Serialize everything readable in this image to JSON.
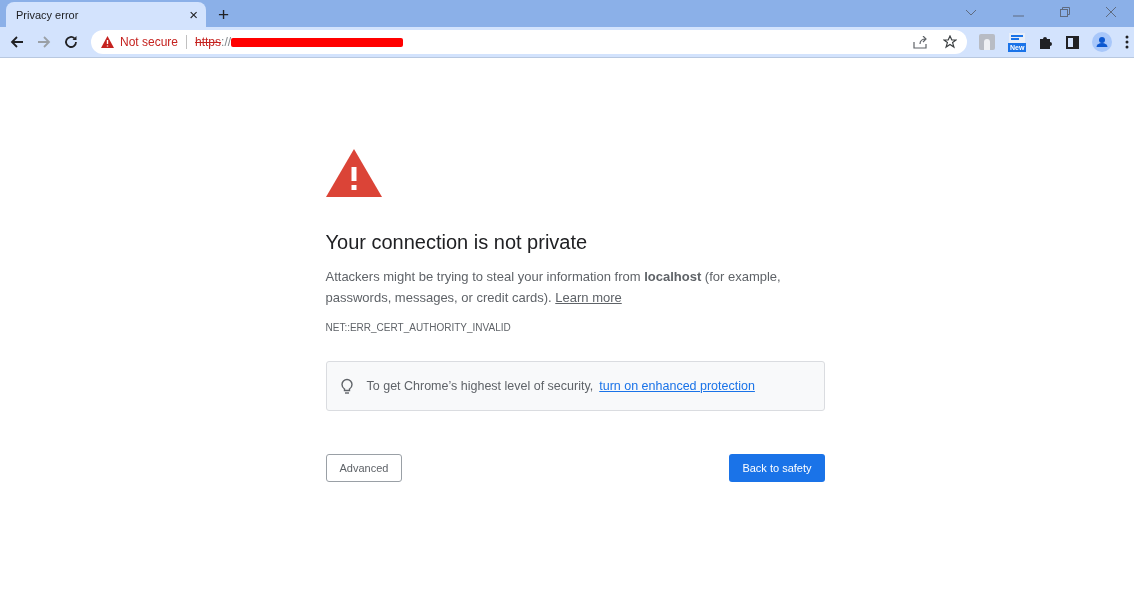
{
  "tab": {
    "title": "Privacy error",
    "close": "×",
    "new_tab": "+"
  },
  "address_bar": {
    "security_label": "Not secure",
    "scheme": "https",
    "rest": "://",
    "redacted": true
  },
  "extension_badge": "New",
  "page": {
    "heading": "Your connection is not private",
    "message": "Attackers might be trying to steal your information from **localhost** (for example, passwords, messages, or credit cards).",
    "learn_more": "Learn more",
    "error_code": "NET::ERR_CERT_AUTHORITY_INVALID",
    "tip_text": "To get Chrome’s highest level of security,",
    "tip_link": "turn on enhanced protection",
    "advanced_button": "Advanced",
    "primary_button": "Back to safety"
  }
}
